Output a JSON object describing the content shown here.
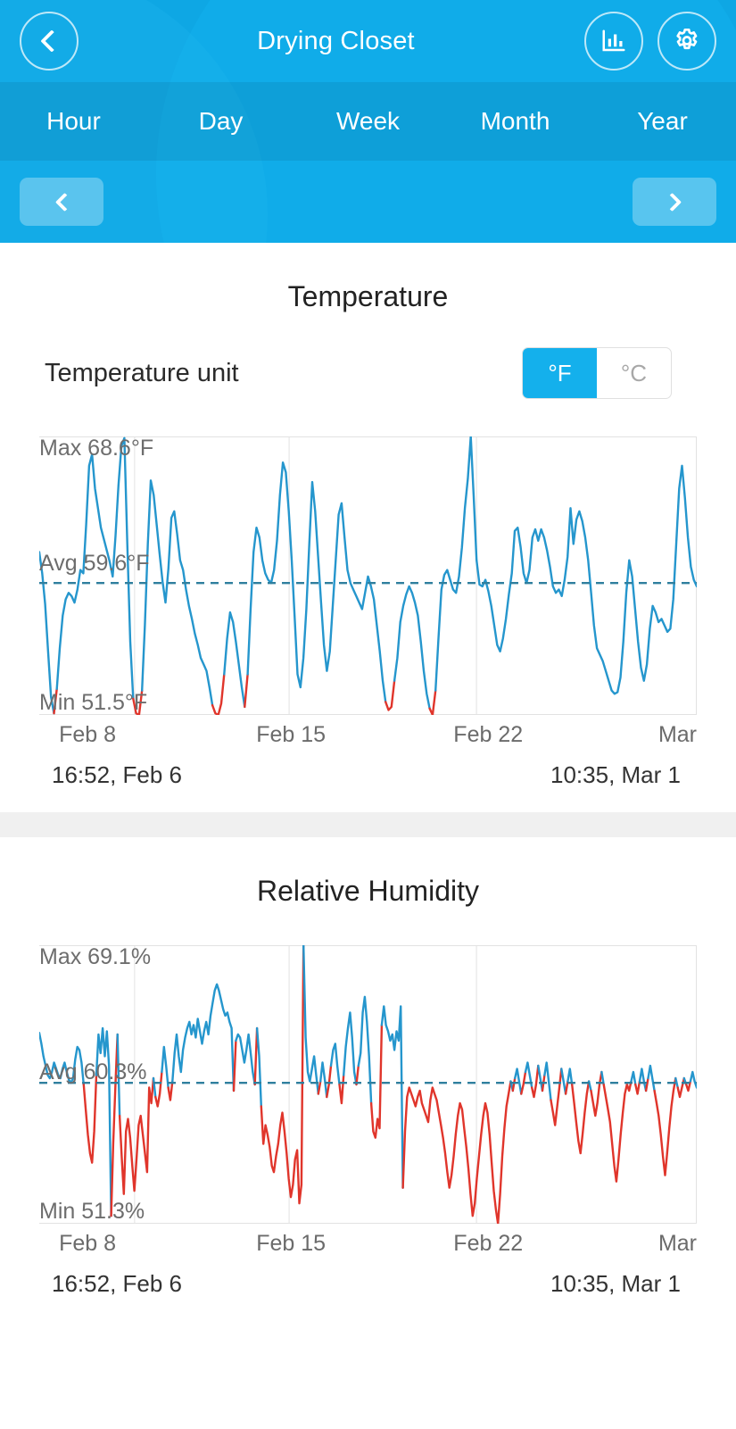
{
  "header": {
    "title": "Drying Closet",
    "back_icon": "chevron-left-icon",
    "stats_icon": "bar-chart-icon",
    "settings_icon": "gear-icon",
    "tabs": [
      {
        "label": "Hour",
        "active": false
      },
      {
        "label": "Day",
        "active": false
      },
      {
        "label": "Week",
        "active": false
      },
      {
        "label": "Month",
        "active": true
      },
      {
        "label": "Year",
        "active": false
      }
    ],
    "pager": {
      "prev_icon": "chevron-left-icon",
      "next_icon": "chevron-right-icon"
    },
    "bg_color": "#0ea7e4",
    "tabbar_color": "#0c9ad2"
  },
  "temperature": {
    "title": "Temperature",
    "unit_label": "Temperature unit",
    "units": [
      {
        "label": "°F",
        "selected": true
      },
      {
        "label": "°C",
        "selected": false
      }
    ],
    "max_label": "Max 68.6°F",
    "avg_label": "Avg 59.6°F",
    "min_label": "Min 51.5°F",
    "range_start": "16:52,  Feb 6",
    "range_end": "10:35,  Mar 1"
  },
  "humidity": {
    "title": "Relative Humidity",
    "max_label": "Max 69.1%",
    "avg_label": "Avg 60.3%",
    "min_label": "Min 51.3%",
    "range_start": "16:52,  Feb 6",
    "range_end": "10:35,  Mar 1"
  },
  "chart_data": [
    {
      "type": "line",
      "title": "Temperature",
      "xlabel": "",
      "ylabel": "°F",
      "ylim": [
        51.5,
        68.6
      ],
      "grid": true,
      "legend": null,
      "max": 68.6,
      "min": 51.5,
      "avg": 59.6,
      "unit": "°F",
      "x_ticks": [
        "Feb 8",
        "Feb 15",
        "Feb 22",
        "Mar"
      ],
      "x_tick_positions": [
        0.145,
        0.38,
        0.665,
        0.95
      ],
      "x_start": "16:52,  Feb 6",
      "x_end": "10:35,  Mar 1",
      "series": [
        {
          "name": "Temperature",
          "color": "#2596cd",
          "below_min_color": "#e0352b",
          "values": [
            61.5,
            60.2,
            58.3,
            55.4,
            52.6,
            51.6,
            53.1,
            55.6,
            57.6,
            58.6,
            59.0,
            58.8,
            58.4,
            59.2,
            60.4,
            60.2,
            63.2,
            66.8,
            67.5,
            65.4,
            64.2,
            63.0,
            62.3,
            61.6,
            60.9,
            60.0,
            62.5,
            65.6,
            68.0,
            68.5,
            62.0,
            56.0,
            52.5,
            51.6,
            51.5,
            53.0,
            57.0,
            62.0,
            65.9,
            65.0,
            63.2,
            61.4,
            59.7,
            58.4,
            60.5,
            63.6,
            64.0,
            62.6,
            61.0,
            60.4,
            59.2,
            58.2,
            57.4,
            56.5,
            55.8,
            55.0,
            54.6,
            54.2,
            53.2,
            52.1,
            51.6,
            51.5,
            52.2,
            54.0,
            56.2,
            57.8,
            57.2,
            56.0,
            54.6,
            53.2,
            52.0,
            54.0,
            58.0,
            61.5,
            63.0,
            62.4,
            61.0,
            60.2,
            59.8,
            59.6,
            60.4,
            62.2,
            65.0,
            67.0,
            66.4,
            64.0,
            61.0,
            57.6,
            54.0,
            53.2,
            55.0,
            58.0,
            62.0,
            65.8,
            64.0,
            61.2,
            58.4,
            55.8,
            54.2,
            55.4,
            58.2,
            61.0,
            63.8,
            64.5,
            62.4,
            60.4,
            59.6,
            59.2,
            58.8,
            58.4,
            58.0,
            59.0,
            60.0,
            59.4,
            58.6,
            57.0,
            55.4,
            53.6,
            52.3,
            51.8,
            52.0,
            53.6,
            55.0,
            57.2,
            58.2,
            58.9,
            59.4,
            59.0,
            58.4,
            57.6,
            56.0,
            54.2,
            52.8,
            51.9,
            51.5,
            53.0,
            56.2,
            59.2,
            60.1,
            60.4,
            59.8,
            59.2,
            59.0,
            60.0,
            61.8,
            64.2,
            66.0,
            68.6,
            65.0,
            61.0,
            59.5,
            59.4,
            59.8,
            59.1,
            58.2,
            57.0,
            55.8,
            55.4,
            56.2,
            57.4,
            58.9,
            60.2,
            62.8,
            63.0,
            61.8,
            60.2,
            59.6,
            60.4,
            62.4,
            62.9,
            62.2,
            62.9,
            62.4,
            61.6,
            60.6,
            59.4,
            59.0,
            59.2,
            58.8,
            59.8,
            61.2,
            64.2,
            62.0,
            63.5,
            64.0,
            63.4,
            62.4,
            61.0,
            59.0,
            57.0,
            55.6,
            55.2,
            54.8,
            54.2,
            53.6,
            53.0,
            52.8,
            52.9,
            53.8,
            56.0,
            59.0,
            61.0,
            60.0,
            58.0,
            56.0,
            54.4,
            53.6,
            54.6,
            56.8,
            58.2,
            57.8,
            57.2,
            57.4,
            57.0,
            56.6,
            56.8,
            58.6,
            62.0,
            65.4,
            66.8,
            64.8,
            62.4,
            60.6,
            59.8,
            59.4
          ]
        }
      ]
    },
    {
      "type": "line",
      "title": "Relative Humidity",
      "xlabel": "",
      "ylabel": "%",
      "ylim": [
        51.3,
        69.1
      ],
      "grid": true,
      "legend": null,
      "max": 69.1,
      "min": 51.3,
      "avg": 60.3,
      "unit": "%",
      "x_ticks": [
        "Feb 8",
        "Feb 15",
        "Feb 22",
        "Mar"
      ],
      "x_tick_positions": [
        0.145,
        0.38,
        0.665,
        0.95
      ],
      "x_start": "16:52,  Feb 6",
      "x_end": "10:35,  Mar 1",
      "series": [
        {
          "name": "Relative Humidity",
          "color": "#2596cd",
          "below_avg_color": "#e0352b",
          "values": [
            63.5,
            62.8,
            62.0,
            61.4,
            60.8,
            60.6,
            61.0,
            61.6,
            61.2,
            60.8,
            60.6,
            61.2,
            61.6,
            61.0,
            60.5,
            60.3,
            60.6,
            61.8,
            62.6,
            62.4,
            61.6,
            60.2,
            58.6,
            57.0,
            55.8,
            55.2,
            57.2,
            60.8,
            63.4,
            62.2,
            63.8,
            62.0,
            63.6,
            61.4,
            51.8,
            56.4,
            60.0,
            63.4,
            58.2,
            55.6,
            53.2,
            57.2,
            58.0,
            56.8,
            55.0,
            53.4,
            55.4,
            57.6,
            58.2,
            57.0,
            55.8,
            54.6,
            60.0,
            59.0,
            60.6,
            59.4,
            58.8,
            59.6,
            61.0,
            62.6,
            61.4,
            60.0,
            59.2,
            60.4,
            62.2,
            63.4,
            62.0,
            61.0,
            62.4,
            63.2,
            63.8,
            64.2,
            63.4,
            64.0,
            63.2,
            64.4,
            63.6,
            62.8,
            63.6,
            64.2,
            63.4,
            64.6,
            65.4,
            66.2,
            66.6,
            66.2,
            65.6,
            65.0,
            64.6,
            64.8,
            64.2,
            63.8,
            59.8,
            63.0,
            63.4,
            63.2,
            62.4,
            61.6,
            62.4,
            63.4,
            62.2,
            61.0,
            60.2,
            63.8,
            62.0,
            58.8,
            56.4,
            57.6,
            57.0,
            56.2,
            55.0,
            54.6,
            55.6,
            56.4,
            57.6,
            58.4,
            57.2,
            55.8,
            54.2,
            53.0,
            53.8,
            55.4,
            56.0,
            52.6,
            53.8,
            69.1,
            63.2,
            61.0,
            60.4,
            61.2,
            62.0,
            60.8,
            59.6,
            60.4,
            61.6,
            60.6,
            59.4,
            60.2,
            61.4,
            62.4,
            62.8,
            61.4,
            60.2,
            59.0,
            60.8,
            62.6,
            63.8,
            64.8,
            63.2,
            61.0,
            60.2,
            61.4,
            62.2,
            64.8,
            65.8,
            64.2,
            62.0,
            59.0,
            57.2,
            56.8,
            58.0,
            57.4,
            64.0,
            65.2,
            64.0,
            63.6,
            63.0,
            63.4,
            62.4,
            63.6,
            63.0,
            65.2,
            53.6,
            57.2,
            59.4,
            60.0,
            59.6,
            59.2,
            58.8,
            59.4,
            59.8,
            59.0,
            58.6,
            58.2,
            57.8,
            59.2,
            60.0,
            59.6,
            59.2,
            58.4,
            57.6,
            56.8,
            55.8,
            54.6,
            53.6,
            54.4,
            55.6,
            57.0,
            58.2,
            59.0,
            58.6,
            57.4,
            56.2,
            54.8,
            53.2,
            51.8,
            52.6,
            54.2,
            55.6,
            57.0,
            58.2,
            59.0,
            58.4,
            57.0,
            55.2,
            53.4,
            52.2,
            51.3,
            53.2,
            55.6,
            57.4,
            58.8,
            59.6,
            60.4,
            59.8,
            60.6,
            61.2,
            60.4,
            59.6,
            60.2,
            61.0,
            61.6,
            60.8,
            60.0,
            59.4,
            60.2,
            61.4,
            60.6,
            59.8,
            60.8,
            61.6,
            60.4,
            59.2,
            58.4,
            57.6,
            58.8,
            60.0,
            61.2,
            60.4,
            59.6,
            60.4,
            61.2,
            60.2,
            59.0,
            57.8,
            56.6,
            55.8,
            57.0,
            58.4,
            59.6,
            60.4,
            59.8,
            59.0,
            58.2,
            59.0,
            60.2,
            61.0,
            60.2,
            59.4,
            58.6,
            57.8,
            56.4,
            55.0,
            54.0,
            55.4,
            57.0,
            58.4,
            59.6,
            60.2,
            59.8,
            60.4,
            61.0,
            60.2,
            59.6,
            60.4,
            61.2,
            60.4,
            59.8,
            60.6,
            61.4,
            60.6,
            59.8,
            59.0,
            58.2,
            57.0,
            55.6,
            54.4,
            55.8,
            57.4,
            58.8,
            59.8,
            60.6,
            60.0,
            59.4,
            60.0,
            60.6,
            60.2,
            59.8,
            60.4,
            61.0,
            60.4,
            60.0
          ]
        }
      ]
    }
  ]
}
